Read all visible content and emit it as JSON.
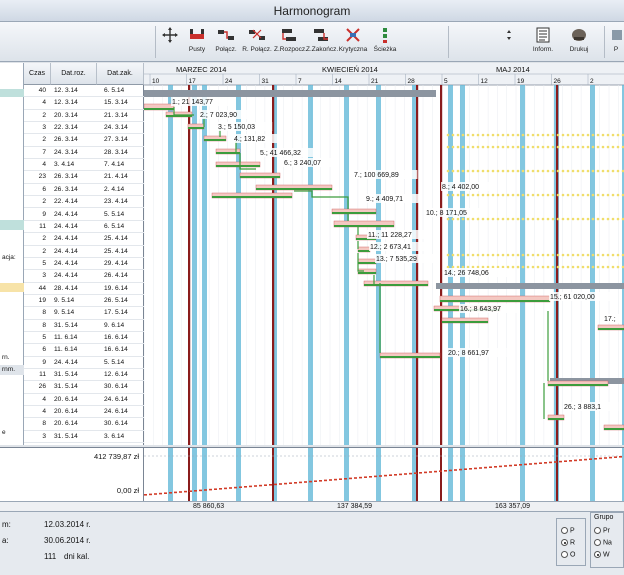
{
  "window": {
    "title": "Harmonogram"
  },
  "toolbar": {
    "buttons": [
      {
        "label": "",
        "icon": "move-icon"
      },
      {
        "label": "Pusty",
        "icon": "bar-empty-icon"
      },
      {
        "label": "Połącz.",
        "icon": "link-icon"
      },
      {
        "label": "R. Połącz.",
        "icon": "unlink-icon"
      },
      {
        "label": "Z.Rozpocz.",
        "icon": "start-icon"
      },
      {
        "label": "Z.Zakończ.",
        "icon": "finish-icon"
      },
      {
        "label": "Krytyczna",
        "icon": "critical-icon"
      },
      {
        "label": "Ścieżka",
        "icon": "path-icon"
      },
      {
        "label": "",
        "icon": "up-down-icon"
      },
      {
        "label": "Inform.",
        "icon": "info-icon"
      },
      {
        "label": "Drukuj",
        "icon": "print-icon"
      },
      {
        "label": "P",
        "icon": "extra-icon"
      }
    ]
  },
  "table": {
    "headers": [
      "Czas",
      "Dat.roz.",
      "Dat.zak."
    ],
    "rows": [
      [
        "40",
        "12. 3.14",
        "6. 5.14"
      ],
      [
        "4",
        "12. 3.14",
        "15. 3.14"
      ],
      [
        "2",
        "20. 3.14",
        "21. 3.14"
      ],
      [
        "3",
        "22. 3.14",
        "24. 3.14"
      ],
      [
        "2",
        "26. 3.14",
        "27. 3.14"
      ],
      [
        "7",
        "24. 3.14",
        "28. 3.14"
      ],
      [
        "4",
        "3. 4.14",
        "7. 4.14"
      ],
      [
        "23",
        "26. 3.14",
        "21. 4.14"
      ],
      [
        "6",
        "26. 3.14",
        "2. 4.14"
      ],
      [
        "2",
        "22. 4.14",
        "23. 4.14"
      ],
      [
        "9",
        "24. 4.14",
        "5. 5.14"
      ],
      [
        "11",
        "24. 4.14",
        "6. 5.14"
      ],
      [
        "2",
        "24. 4.14",
        "25. 4.14"
      ],
      [
        "2",
        "24. 4.14",
        "25. 4.14"
      ],
      [
        "5",
        "24. 4.14",
        "29. 4.14"
      ],
      [
        "3",
        "24. 4.14",
        "26. 4.14"
      ],
      [
        "44",
        "28. 4.14",
        "19. 6.14"
      ],
      [
        "19",
        "9. 5.14",
        "26. 5.14"
      ],
      [
        "8",
        "9. 5.14",
        "17. 5.14"
      ],
      [
        "8",
        "31. 5.14",
        "9. 6.14"
      ],
      [
        "5",
        "11. 6.14",
        "16. 6.14"
      ],
      [
        "6",
        "11. 6.14",
        "16. 6.14"
      ],
      [
        "9",
        "24. 4.14",
        "5. 5.14"
      ],
      [
        "11",
        "31. 5.14",
        "12. 6.14"
      ],
      [
        "26",
        "31. 5.14",
        "30. 6.14"
      ],
      [
        "4",
        "20. 6.14",
        "24. 6.14"
      ],
      [
        "4",
        "20. 6.14",
        "24. 6.14"
      ],
      [
        "8",
        "20. 6.14",
        "30. 6.14"
      ],
      [
        "3",
        "31. 5.14",
        "3. 6.14"
      ]
    ]
  },
  "left_labels": [
    "acja:",
    "rn.",
    "rnm.",
    "e"
  ],
  "gantt": {
    "months": [
      "MARZEC 2014",
      "KWIECIEŃ 2014",
      "MAJ 2014"
    ],
    "day_ticks": [
      "10",
      "17",
      "24",
      "31",
      "7",
      "14",
      "21",
      "28",
      "5",
      "12",
      "19",
      "26",
      "2"
    ],
    "labels": [
      "1.; 21 143,77",
      "2.; 7 023,90",
      "3.; 5 150,03",
      "4.; 131,82",
      "5.; 41 466,32",
      "6.; 3 240,07",
      "7.; 100 669,89",
      "8.; 4 402,00",
      "9.; 4 409,71",
      "10.; 8 171,05",
      "11.; 11 228,27",
      "12.; 2 673,41",
      "13.; 7 535,29",
      "14.; 26 748,06",
      "15.; 61 020,00",
      "16.; 8 643,97",
      "17.;",
      "20.; 8 661,97",
      "26.; 3 883,1"
    ]
  },
  "summary": {
    "top_value": "412 739,87 zł",
    "zero_value": "0,00 zł",
    "checkpoints": [
      "85 860,63",
      "137 384,59",
      "163 357,09"
    ]
  },
  "footer": {
    "start_label": "m:",
    "start_date": "12.03.2014 r.",
    "end_label": "a:",
    "end_date": "30.06.2014 r.",
    "days_value": "111",
    "days_unit": "dni kal.",
    "radio_group_1": [
      "P",
      "R",
      "O"
    ],
    "group_title": "Grupo",
    "radio_group_2": [
      "Pr",
      "Na",
      "W"
    ]
  },
  "colors": {
    "accent_blue": "#5ab4d6",
    "dark_red": "#8a1c1c",
    "green_bar": "#3c9c3c",
    "red_line": "#d23c28"
  }
}
